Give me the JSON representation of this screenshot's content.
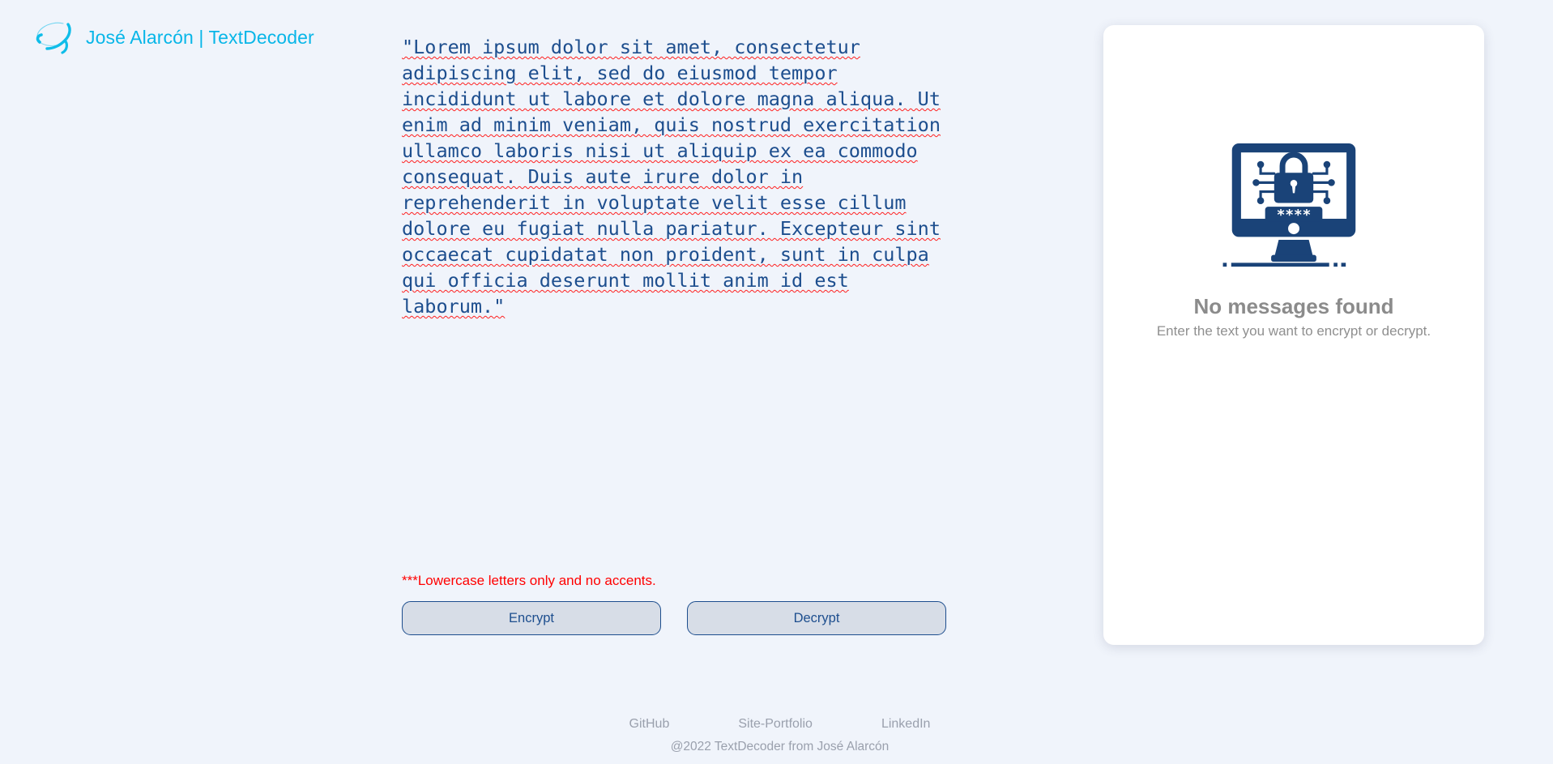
{
  "header": {
    "logo_icon": "swoosh-orbit-logo",
    "brand_title": "José Alarcón | TextDecoder",
    "brand_color": "#08b6e8"
  },
  "editor": {
    "input_name": "message-textarea",
    "placeholder": "Enter your text here",
    "value": "\"Lorem ipsum dolor sit amet, consectetur adipiscing elit, sed do eiusmod tempor incididunt ut labore et dolore magna aliqua. Ut enim ad minim veniam, quis nostrud exercitation ullamco laboris nisi ut aliquip ex ea commodo consequat. Duis aute irure dolor in reprehenderit in voluptate velit esse cillum dolore eu fugiat nulla pariatur. Excepteur sint occaecat cupidatat non proident, sunt in culpa qui officia deserunt mollit anim id est laborum.\"",
    "text_color": "#1d4e8e"
  },
  "warning": {
    "text": "***Lowercase letters only and no accents.",
    "color": "#ff0000"
  },
  "actions": {
    "encrypt_label": "Encrypt",
    "decrypt_label": "Decrypt",
    "button_bg": "#d7dde7",
    "button_border": "#1d4e8e"
  },
  "result_panel": {
    "illustration_icon": "monitor-padlock-password-icon",
    "illustration_color": "#1a4378",
    "empty_title": "No messages found",
    "empty_subtitle": "Enter the text you want to encrypt or decrypt.",
    "card_bg": "#ffffff",
    "text_color": "#8b8b8b"
  },
  "footer": {
    "links": [
      {
        "label": "GitHub"
      },
      {
        "label": "Site-Portfolio"
      },
      {
        "label": "LinkedIn"
      }
    ],
    "copyright": "@2022 TextDecoder from José Alarcón",
    "text_color": "#9aa0ad"
  },
  "page": {
    "background": "#f0f4fb"
  }
}
